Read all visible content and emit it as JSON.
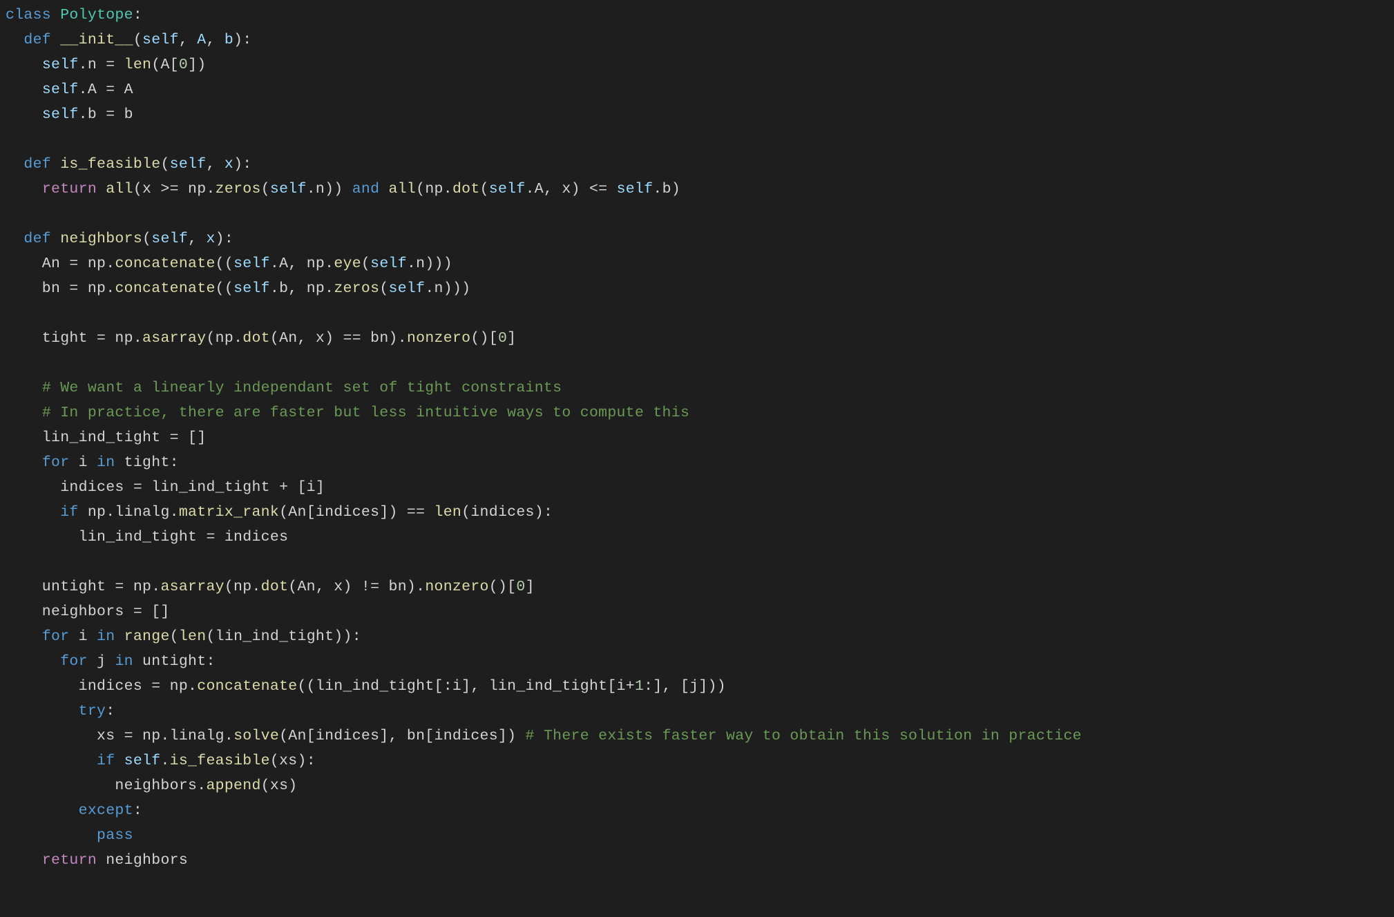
{
  "language": "python",
  "class_name": "Polytope",
  "methods": [
    "__init__",
    "is_feasible",
    "neighbors"
  ],
  "comments": [
    "# We want a linearly independant set of tight constraints",
    "# In practice, there are faster but less intuitive ways to compute this",
    "# There exists faster way to obtain this solution in practice"
  ],
  "code_lines": [
    {
      "i": 0,
      "t": "class Polytope:"
    },
    {
      "i": 1,
      "t": "  def __init__(self, A, b):"
    },
    {
      "i": 2,
      "t": "    self.n = len(A[0])"
    },
    {
      "i": 3,
      "t": "    self.A = A"
    },
    {
      "i": 4,
      "t": "    self.b = b"
    },
    {
      "i": 5,
      "t": ""
    },
    {
      "i": 6,
      "t": "  def is_feasible(self, x):"
    },
    {
      "i": 7,
      "t": "    return all(x >= np.zeros(self.n)) and all(np.dot(self.A, x) <= self.b)"
    },
    {
      "i": 8,
      "t": ""
    },
    {
      "i": 9,
      "t": "  def neighbors(self, x):"
    },
    {
      "i": 10,
      "t": "    An = np.concatenate((self.A, np.eye(self.n)))"
    },
    {
      "i": 11,
      "t": "    bn = np.concatenate((self.b, np.zeros(self.n)))"
    },
    {
      "i": 12,
      "t": ""
    },
    {
      "i": 13,
      "t": "    tight = np.asarray(np.dot(An, x) == bn).nonzero()[0]"
    },
    {
      "i": 14,
      "t": ""
    },
    {
      "i": 15,
      "t": "    # We want a linearly independant set of tight constraints"
    },
    {
      "i": 16,
      "t": "    # In practice, there are faster but less intuitive ways to compute this"
    },
    {
      "i": 17,
      "t": "    lin_ind_tight = []"
    },
    {
      "i": 18,
      "t": "    for i in tight:"
    },
    {
      "i": 19,
      "t": "      indices = lin_ind_tight + [i]"
    },
    {
      "i": 20,
      "t": "      if np.linalg.matrix_rank(An[indices]) == len(indices):"
    },
    {
      "i": 21,
      "t": "        lin_ind_tight = indices"
    },
    {
      "i": 22,
      "t": ""
    },
    {
      "i": 23,
      "t": "    untight = np.asarray(np.dot(An, x) != bn).nonzero()[0]"
    },
    {
      "i": 24,
      "t": "    neighbors = []"
    },
    {
      "i": 25,
      "t": "    for i in range(len(lin_ind_tight)):"
    },
    {
      "i": 26,
      "t": "      for j in untight:"
    },
    {
      "i": 27,
      "t": "        indices = np.concatenate((lin_ind_tight[:i], lin_ind_tight[i+1:], [j]))"
    },
    {
      "i": 28,
      "t": "        try:"
    },
    {
      "i": 29,
      "t": "          xs = np.linalg.solve(An[indices], bn[indices]) # There exists faster way to obtain this solution in practice"
    },
    {
      "i": 30,
      "t": "          if self.is_feasible(xs):"
    },
    {
      "i": 31,
      "t": "            neighbors.append(xs)"
    },
    {
      "i": 32,
      "t": "        except:"
    },
    {
      "i": 33,
      "t": "          pass"
    },
    {
      "i": 34,
      "t": "    return neighbors"
    }
  ]
}
